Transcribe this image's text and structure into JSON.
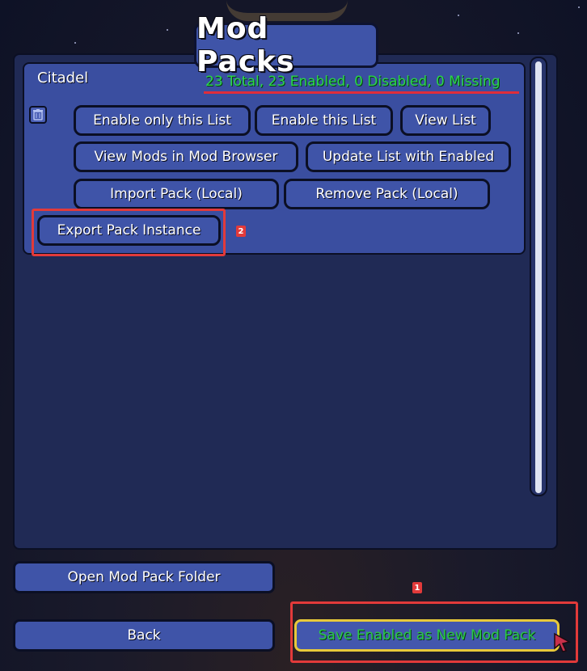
{
  "title": "Mod Packs",
  "pack": {
    "name": "Citadel",
    "stats": "23 Total, 23 Enabled, 0 Disabled, 0 Missing"
  },
  "buttons": {
    "enable_only": "Enable only this List",
    "enable_this": "Enable this List",
    "view_list": "View List",
    "view_mods_browser": "View Mods in Mod Browser",
    "update_list": "Update List with Enabled",
    "import_pack": "Import Pack (Local)",
    "remove_pack": "Remove Pack (Local)",
    "export_instance": "Export Pack Instance",
    "open_folder": "Open Mod Pack Folder",
    "back": "Back",
    "save_enabled": "Save Enabled as New Mod Pack"
  },
  "annotations": {
    "badge1": "1",
    "badge2": "2"
  },
  "colors": {
    "panel": "#202a55",
    "card": "#3a4ea0",
    "button": "#3f54a8",
    "stats_text": "#2bd54a",
    "highlight": "#e23a3a",
    "save_border": "#e8c93a"
  },
  "icons": {
    "trash": "trash-icon",
    "cursor": "mouse-cursor-icon"
  }
}
